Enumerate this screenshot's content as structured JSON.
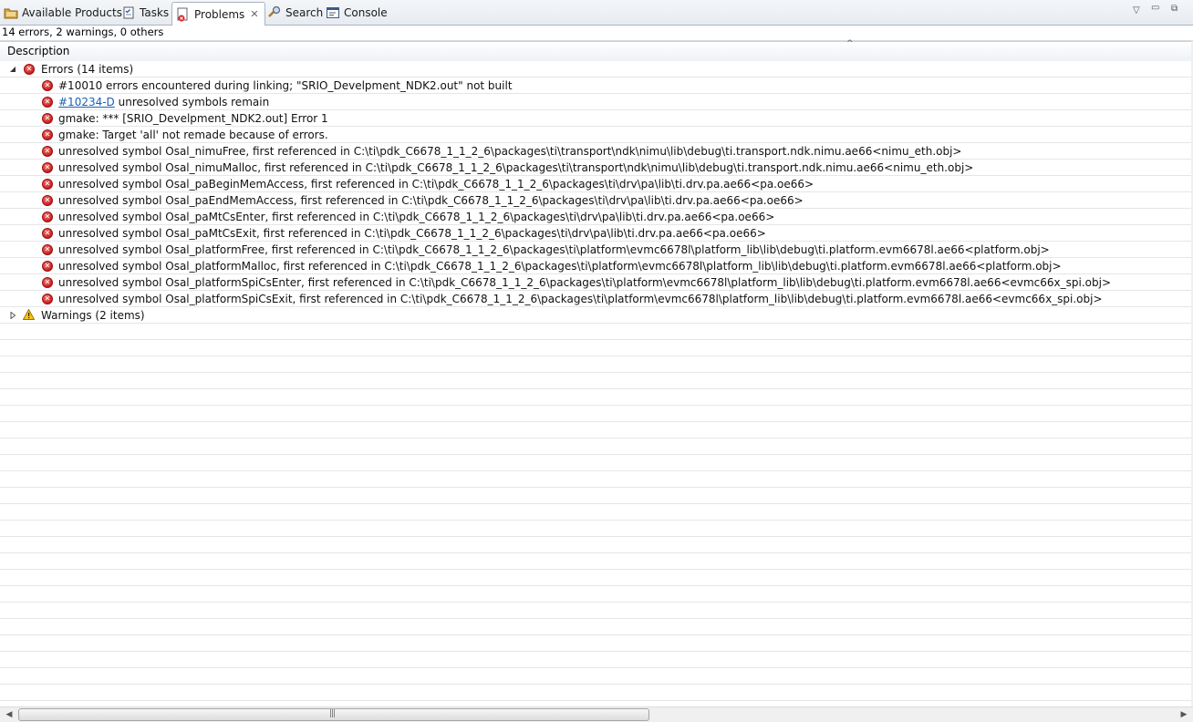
{
  "tabs": [
    {
      "label": "Available Products",
      "icon": "products-icon",
      "active": false
    },
    {
      "label": "Tasks",
      "icon": "tasks-icon",
      "active": false
    },
    {
      "label": "Problems",
      "icon": "problems-icon",
      "active": true
    },
    {
      "label": "Search",
      "icon": "search-icon",
      "active": false
    },
    {
      "label": "Console",
      "icon": "console-icon",
      "active": false
    }
  ],
  "summary": "14 errors, 2 warnings, 0 others",
  "column_header": "Description",
  "errors_group": {
    "label": "Errors (14 items)",
    "expanded": true
  },
  "warnings_group": {
    "label": "Warnings (2 items)",
    "expanded": false
  },
  "errors": [
    {
      "text": "#10010 errors encountered during linking; \"SRIO_Develpment_NDK2.out\" not built"
    },
    {
      "link": "#10234-D",
      "text": " unresolved symbols remain"
    },
    {
      "text": "gmake: *** [SRIO_Develpment_NDK2.out] Error 1"
    },
    {
      "text": "gmake: Target 'all' not remade because of errors."
    },
    {
      "text": "unresolved symbol Osal_nimuFree, first referenced in C:\\ti\\pdk_C6678_1_1_2_6\\packages\\ti\\transport\\ndk\\nimu\\lib\\debug\\ti.transport.ndk.nimu.ae66<nimu_eth.obj>"
    },
    {
      "text": "unresolved symbol Osal_nimuMalloc, first referenced in C:\\ti\\pdk_C6678_1_1_2_6\\packages\\ti\\transport\\ndk\\nimu\\lib\\debug\\ti.transport.ndk.nimu.ae66<nimu_eth.obj>"
    },
    {
      "text": "unresolved symbol Osal_paBeginMemAccess, first referenced in C:\\ti\\pdk_C6678_1_1_2_6\\packages\\ti\\drv\\pa\\lib\\ti.drv.pa.ae66<pa.oe66>"
    },
    {
      "text": "unresolved symbol Osal_paEndMemAccess, first referenced in C:\\ti\\pdk_C6678_1_1_2_6\\packages\\ti\\drv\\pa\\lib\\ti.drv.pa.ae66<pa.oe66>"
    },
    {
      "text": "unresolved symbol Osal_paMtCsEnter, first referenced in C:\\ti\\pdk_C6678_1_1_2_6\\packages\\ti\\drv\\pa\\lib\\ti.drv.pa.ae66<pa.oe66>"
    },
    {
      "text": "unresolved symbol Osal_paMtCsExit, first referenced in C:\\ti\\pdk_C6678_1_1_2_6\\packages\\ti\\drv\\pa\\lib\\ti.drv.pa.ae66<pa.oe66>"
    },
    {
      "text": "unresolved symbol Osal_platformFree, first referenced in C:\\ti\\pdk_C6678_1_1_2_6\\packages\\ti\\platform\\evmc6678l\\platform_lib\\lib\\debug\\ti.platform.evm6678l.ae66<platform.obj>"
    },
    {
      "text": "unresolved symbol Osal_platformMalloc, first referenced in C:\\ti\\pdk_C6678_1_1_2_6\\packages\\ti\\platform\\evmc6678l\\platform_lib\\lib\\debug\\ti.platform.evm6678l.ae66<platform.obj>"
    },
    {
      "text": "unresolved symbol Osal_platformSpiCsEnter, first referenced in C:\\ti\\pdk_C6678_1_1_2_6\\packages\\ti\\platform\\evmc6678l\\platform_lib\\lib\\debug\\ti.platform.evm6678l.ae66<evmc66x_spi.obj>"
    },
    {
      "text": "unresolved symbol Osal_platformSpiCsExit, first referenced in C:\\ti\\pdk_C6678_1_1_2_6\\packages\\ti\\platform\\evmc6678l\\platform_lib\\lib\\debug\\ti.platform.evm6678l.ae66<evmc66x_spi.obj>"
    }
  ],
  "colors": {
    "error": "#c81e1e",
    "warning": "#e8b400",
    "link": "#1a5fb4",
    "tab_border": "#a9b4c2"
  }
}
